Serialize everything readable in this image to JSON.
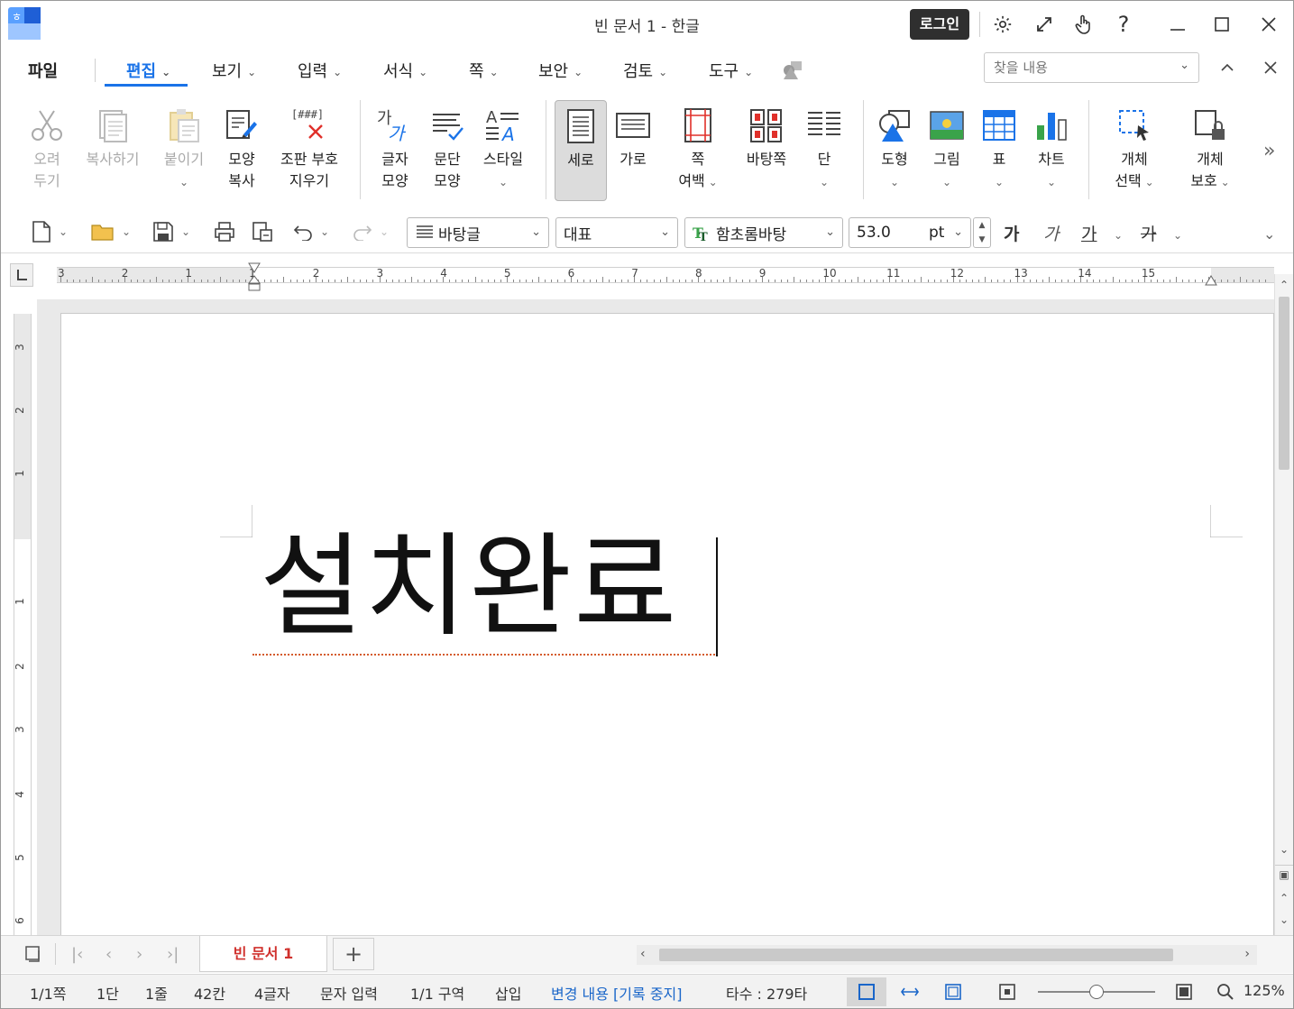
{
  "window": {
    "title": "빈 문서 1 - 한글",
    "login_label": "로그인"
  },
  "menu": {
    "file": "파일",
    "items": [
      "편집",
      "보기",
      "입력",
      "서식",
      "쪽",
      "보안",
      "검토",
      "도구"
    ],
    "active": "편집",
    "search_placeholder": "찾을 내용"
  },
  "ribbon": {
    "cut": [
      "오려",
      "두기"
    ],
    "copy": "복사하기",
    "paste": "붙이기",
    "format_copy": [
      "모양",
      "복사"
    ],
    "clear_codes": [
      "조판 부호",
      "지우기"
    ],
    "char_shape": [
      "글자",
      "모양"
    ],
    "para_shape": [
      "문단",
      "모양"
    ],
    "style": "스타일",
    "portrait": "세로",
    "landscape": "가로",
    "page_margin": [
      "쪽",
      "여백"
    ],
    "master_page": "바탕쪽",
    "columns": "단",
    "shape": "도형",
    "picture": "그림",
    "table": "표",
    "chart": "차트",
    "object_select": [
      "개체",
      "선택"
    ],
    "object_protect": [
      "개체",
      "보호"
    ],
    "clear_codes_icon_text": "[###]"
  },
  "toolbar": {
    "style_value": "바탕글",
    "lang_value": "대표",
    "font_value": "함초롬바탕",
    "size_value": "53.0",
    "size_unit": "pt",
    "bold": "가",
    "italic": "가",
    "underline": "가",
    "strike": "가"
  },
  "ruler": {
    "h_numbers": [
      "3",
      "2",
      "1",
      "1",
      "2",
      "3",
      "4",
      "5",
      "6",
      "7",
      "8",
      "9",
      "10",
      "11",
      "12",
      "13",
      "14",
      "15"
    ],
    "v_numbers": [
      "3",
      "2",
      "1",
      "1",
      "2",
      "3",
      "4",
      "5",
      "6"
    ]
  },
  "document": {
    "text": "설치완료"
  },
  "tabs": {
    "doc_tab": "빈 문서 1",
    "add": "+"
  },
  "status": {
    "page": "1/1쪽",
    "column": "1단",
    "line": "1줄",
    "col_pos": "42칸",
    "chars": "4글자",
    "mode": "문자 입력",
    "section": "1/1 구역",
    "insert": "삽입",
    "track_changes": "변경 내용 [기록 중지]",
    "keystrokes": "타수 : 279타",
    "zoom": "125%",
    "zoom_fraction": 0.5
  },
  "colors": {
    "accent": "#1a73e8",
    "tab_text": "#d0312d",
    "login_bg": "#2f2f2f"
  }
}
